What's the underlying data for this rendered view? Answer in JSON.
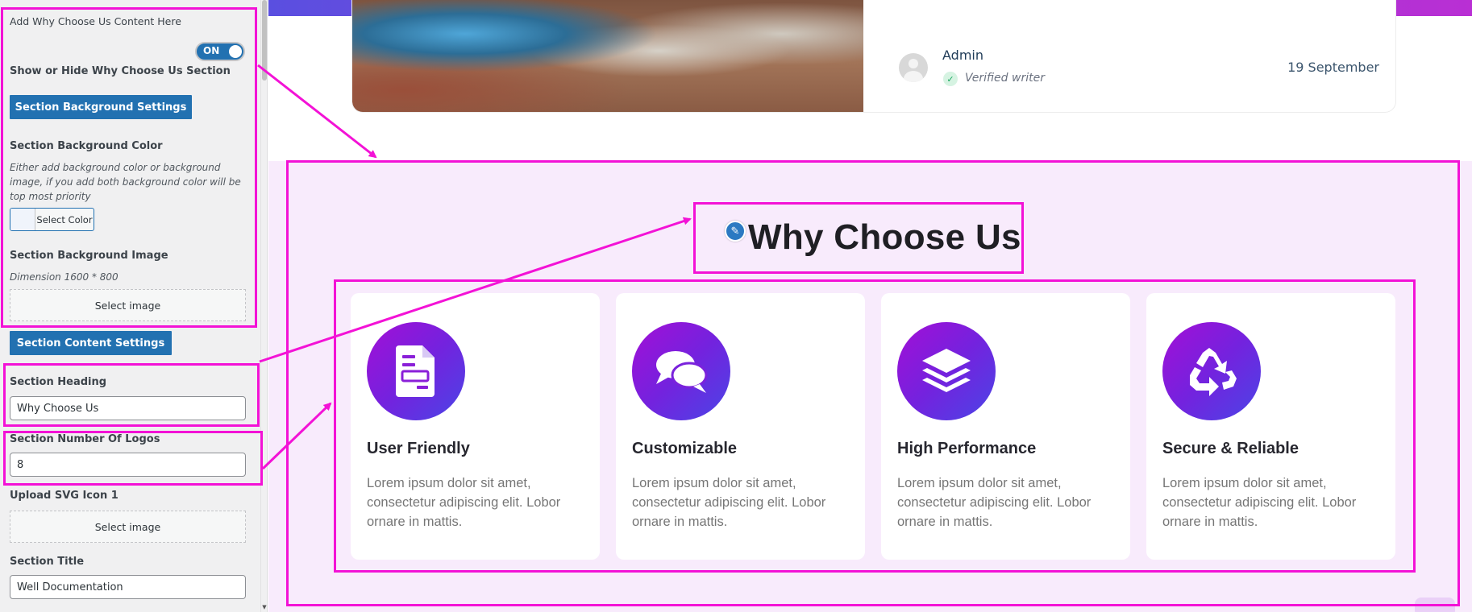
{
  "panel": {
    "top_note": "Add Why Choose Us Content Here",
    "toggle_label": "ON",
    "toggle_caption": "Show or Hide Why Choose Us Section",
    "bg_settings_button": "Section Background Settings",
    "bg_color_label": "Section Background Color",
    "bg_color_description": "Either add background color or background image, if you add both background color will be top most priority",
    "select_color_label": "Select Color",
    "bg_image_label": "Section Background Image",
    "bg_image_dimension": "Dimension 1600 * 800",
    "select_image_label": "Select image",
    "content_settings_button": "Section Content Settings",
    "heading_label": "Section Heading",
    "heading_value": "Why Choose Us",
    "logos_label": "Section Number Of Logos",
    "logos_value": "8",
    "svg_icon_label": "Upload SVG Icon 1",
    "svg_select_image_label": "Select image",
    "title_label": "Section Title",
    "title_value": "Well Documentation"
  },
  "preview": {
    "post": {
      "author": "Admin",
      "verified": "Verified writer",
      "date": "19 September"
    },
    "section_heading": "Why Choose Us",
    "features": [
      {
        "title": "User Friendly",
        "description": "Lorem ipsum dolor sit amet, consectetur adipiscing elit. Lobor ornare in mattis.",
        "icon": "document-icon"
      },
      {
        "title": "Customizable",
        "description": "Lorem ipsum dolor sit amet, consectetur adipiscing elit. Lobor ornare in mattis.",
        "icon": "chat-bubbles-icon"
      },
      {
        "title": "High Performance",
        "description": "Lorem ipsum dolor sit amet, consectetur adipiscing elit. Lobor ornare in mattis.",
        "icon": "layers-icon"
      },
      {
        "title": "Secure & Reliable",
        "description": "Lorem ipsum dolor sit amet, consectetur adipiscing elit. Lobor ornare in mattis.",
        "icon": "recycle-icon"
      }
    ]
  },
  "colors": {
    "annotation": "#f312d6",
    "wp_blue": "#2271b1",
    "icon_gradient_start": "#a30fd6",
    "icon_gradient_end": "#4a45e6",
    "section_background": "#f8ebfc"
  }
}
